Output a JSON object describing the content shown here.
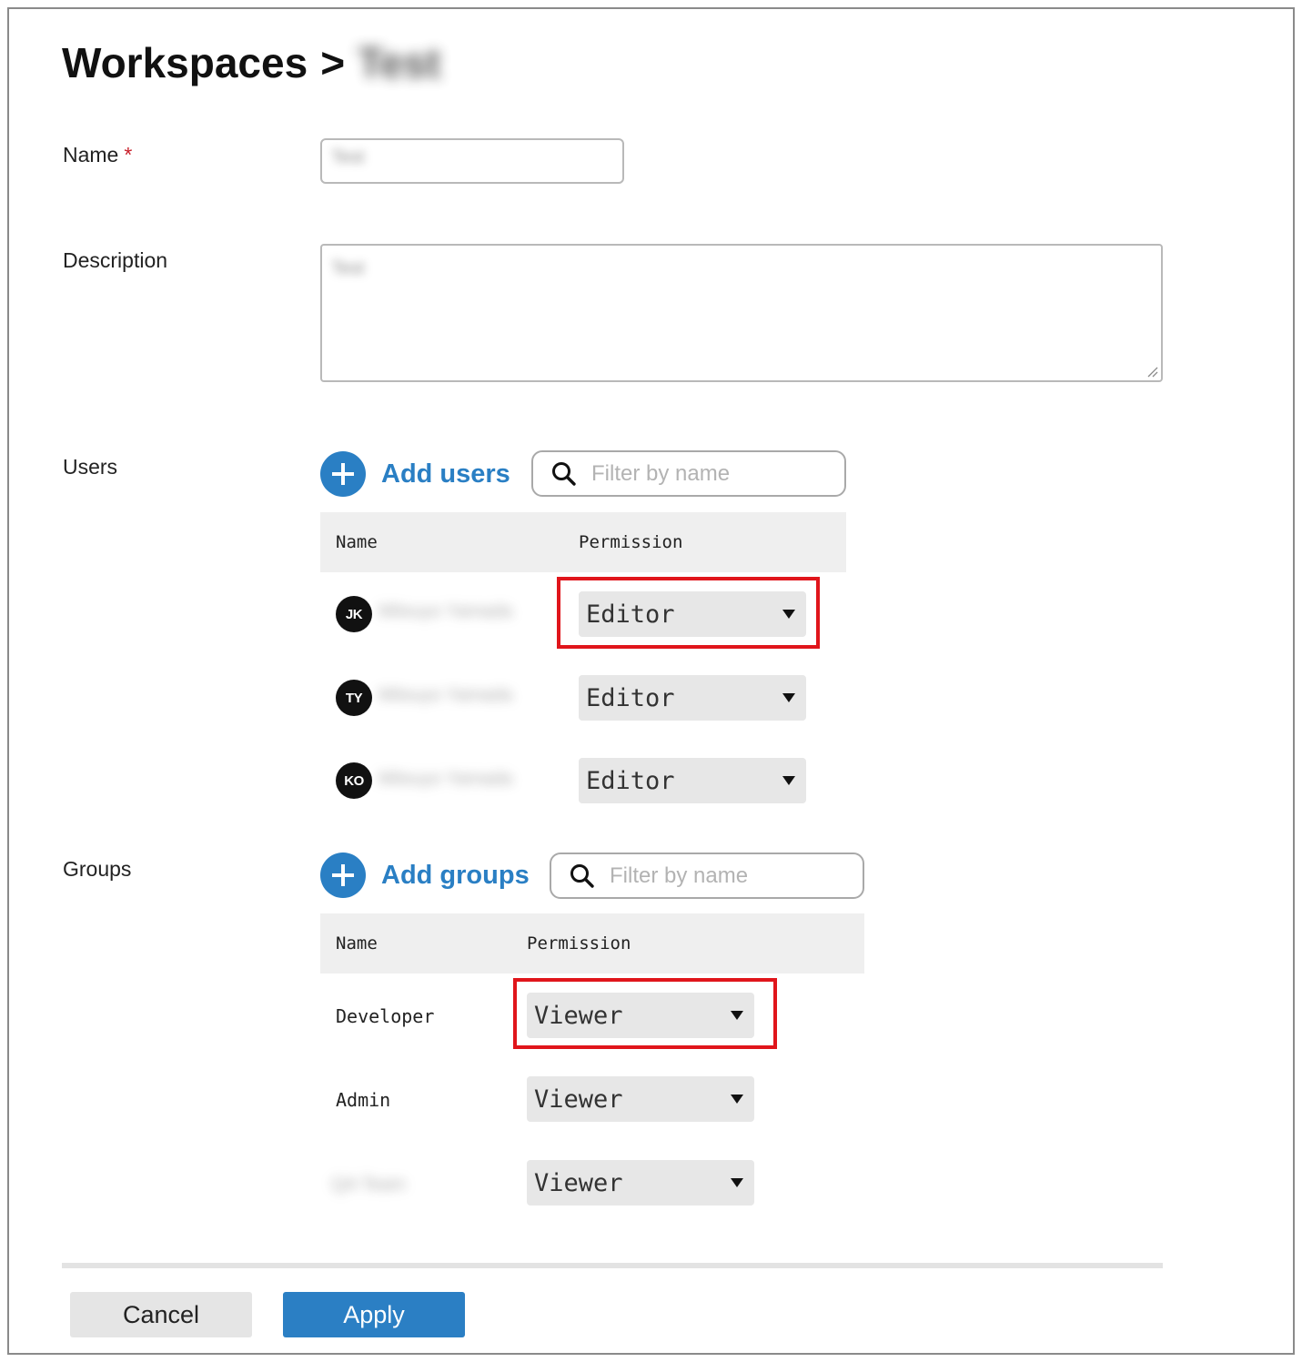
{
  "header": {
    "breadcrumb_root": "Workspaces",
    "breadcrumb_separator": ">",
    "breadcrumb_current": "Test"
  },
  "form": {
    "name_label": "Name",
    "required_marker": "*",
    "name_value": "Test",
    "description_label": "Description",
    "description_value": "Test",
    "users_label": "Users",
    "groups_label": "Groups"
  },
  "users": {
    "add_label": "Add users",
    "filter_placeholder": "Filter by name",
    "columns": {
      "name": "Name",
      "permission": "Permission"
    },
    "rows": [
      {
        "initials": "JK",
        "name": "Mitsuyo Yamada",
        "permission": "Editor"
      },
      {
        "initials": "TY",
        "name": "Mitsuyo Yamada",
        "permission": "Editor"
      },
      {
        "initials": "KO",
        "name": "Mitsuyo Yamada",
        "permission": "Editor"
      }
    ]
  },
  "groups": {
    "add_label": "Add groups",
    "filter_placeholder": "Filter by name",
    "columns": {
      "name": "Name",
      "permission": "Permission"
    },
    "rows": [
      {
        "name": "Developer",
        "permission": "Viewer"
      },
      {
        "name": "Admin",
        "permission": "Viewer"
      },
      {
        "name": "QA Team",
        "permission": "Viewer"
      }
    ]
  },
  "footer": {
    "cancel_label": "Cancel",
    "apply_label": "Apply"
  },
  "colors": {
    "accent": "#2a7fc4",
    "highlight": "#e0151b",
    "required": "#c8202a"
  }
}
